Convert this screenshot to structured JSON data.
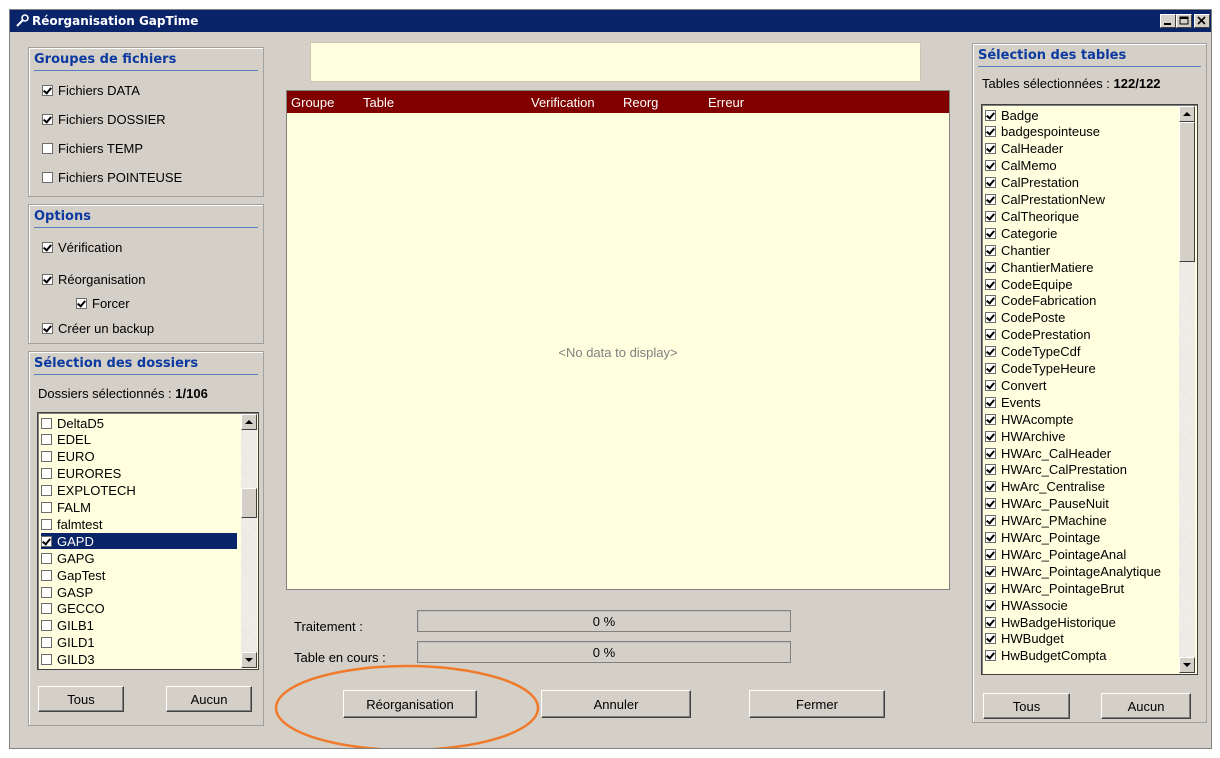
{
  "window": {
    "title": "Réorganisation GapTime"
  },
  "groupes": {
    "title": "Groupes de fichiers",
    "items": [
      {
        "label": "Fichiers DATA",
        "checked": true
      },
      {
        "label": "Fichiers DOSSIER",
        "checked": true
      },
      {
        "label": "Fichiers TEMP",
        "checked": false
      },
      {
        "label": "Fichiers POINTEUSE",
        "checked": false
      }
    ]
  },
  "options": {
    "title": "Options",
    "verification": {
      "label": "Vérification",
      "checked": true
    },
    "reorganisation": {
      "label": "Réorganisation",
      "checked": true
    },
    "forcer": {
      "label": "Forcer",
      "checked": true
    },
    "backup": {
      "label": "Créer un backup",
      "checked": true
    }
  },
  "dossiers": {
    "title": "Sélection des dossiers",
    "count_label": "Dossiers sélectionnés :",
    "count": "1/106",
    "items": [
      {
        "label": "DeltaD5",
        "checked": false
      },
      {
        "label": "EDEL",
        "checked": false
      },
      {
        "label": "EURO",
        "checked": false
      },
      {
        "label": "EURORES",
        "checked": false
      },
      {
        "label": "EXPLOTECH",
        "checked": false
      },
      {
        "label": "FALM",
        "checked": false
      },
      {
        "label": "falmtest",
        "checked": false
      },
      {
        "label": "GAPD",
        "checked": true,
        "selected": true
      },
      {
        "label": "GAPG",
        "checked": false
      },
      {
        "label": "GapTest",
        "checked": false
      },
      {
        "label": "GASP",
        "checked": false
      },
      {
        "label": "GECCO",
        "checked": false
      },
      {
        "label": "GILB1",
        "checked": false
      },
      {
        "label": "GILD1",
        "checked": false
      },
      {
        "label": "GILD3",
        "checked": false
      }
    ],
    "btn_all": "Tous",
    "btn_none": "Aucun"
  },
  "grid": {
    "columns": [
      "Groupe",
      "Table",
      "Verification",
      "Reorg",
      "Erreur"
    ],
    "empty_text": "<No data to display>"
  },
  "progress": {
    "traitement_label": "Traitement :",
    "traitement_value": "0 %",
    "table_label": "Table en cours :",
    "table_value": "0 %"
  },
  "actions": {
    "reorganisation": "Réorganisation",
    "annuler": "Annuler",
    "fermer": "Fermer"
  },
  "tables": {
    "title": "Sélection des tables",
    "count_label": "Tables sélectionnées :",
    "count": "122/122",
    "items": [
      "Badge",
      "badgespointeuse",
      "CalHeader",
      "CalMemo",
      "CalPrestation",
      "CalPrestationNew",
      "CalTheorique",
      "Categorie",
      "Chantier",
      "ChantierMatiere",
      "CodeEquipe",
      "CodeFabrication",
      "CodePoste",
      "CodePrestation",
      "CodeTypeCdf",
      "CodeTypeHeure",
      "Convert",
      "Events",
      "HWAcompte",
      "HWArchive",
      "HWArc_CalHeader",
      "HWArc_CalPrestation",
      "HwArc_Centralise",
      "HWArc_PauseNuit",
      "HWArc_PMachine",
      "HWArc_Pointage",
      "HWArc_PointageAnal",
      "HWArc_PointageAnalytique",
      "HWArc_PointageBrut",
      "HWAssocie",
      "HwBadgeHistorique",
      "HWBudget",
      "HwBudgetCompta"
    ],
    "btn_all": "Tous",
    "btn_none": "Aucun"
  },
  "colors": {
    "title_bar": "#0a246a",
    "group_heading": "#0c3aa0",
    "grid_header": "#800000",
    "list_bg": "#ffffe0",
    "annotation": "#f07a2a"
  }
}
